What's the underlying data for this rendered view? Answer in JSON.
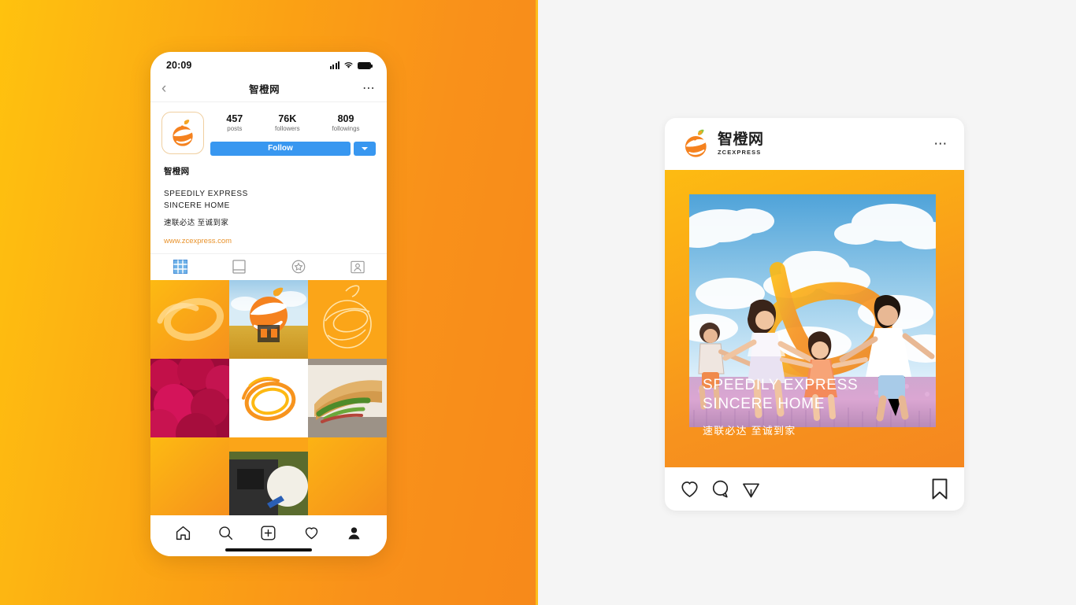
{
  "theme": {
    "brand_orange": "#F7931E",
    "brand_yellow": "#FFC20E",
    "link_orange": "#E8922B",
    "follow_blue": "#3897F0",
    "page_background": "#F5F5F5"
  },
  "phone": {
    "status_bar": {
      "time": "20:09",
      "icons": [
        "signal-icon",
        "wifi-icon",
        "battery-icon"
      ]
    },
    "nav": {
      "back_icon": "chevron-left-icon",
      "title": "智橙网",
      "more_icon": "more-horizontal-icon"
    },
    "profile": {
      "avatar_icon": "orange-logo-avatar",
      "stats": [
        {
          "value": "457",
          "label": "posts"
        },
        {
          "value": "76K",
          "label": "followers"
        },
        {
          "value": "809",
          "label": "followings"
        }
      ],
      "follow_label": "Follow",
      "follow_caret_icon": "chevron-down-icon",
      "bio_name": "智橙网",
      "bio_en_line1": "SPEEDILY EXPRESS",
      "bio_en_line2": "SINCERE HOME",
      "bio_cn": "速联必达 至诚到家",
      "bio_url": "www.zcexpress.com"
    },
    "tabs": [
      {
        "name": "tab-grid",
        "icon": "grid-icon",
        "active": true
      },
      {
        "name": "tab-feed",
        "icon": "list-card-icon",
        "active": false
      },
      {
        "name": "tab-saved",
        "icon": "star-circle-icon",
        "active": false
      },
      {
        "name": "tab-tagged",
        "icon": "person-card-icon",
        "active": false
      }
    ],
    "grid_posts": [
      {
        "name": "post-swirl-yellow",
        "kind": "orange-swirl-light"
      },
      {
        "name": "post-logo-field",
        "kind": "logo-over-field"
      },
      {
        "name": "post-outline-orange",
        "kind": "orange-outline"
      },
      {
        "name": "post-red-texture",
        "kind": "red-velvet-texture"
      },
      {
        "name": "post-swirl-white",
        "kind": "orange-swirl-white"
      },
      {
        "name": "post-sandwich",
        "kind": "baguette-sandwich"
      },
      {
        "name": "post-plain-orange-1",
        "kind": "flat-orange"
      },
      {
        "name": "post-worker",
        "kind": "worker-hat"
      },
      {
        "name": "post-plain-orange-2",
        "kind": "flat-orange"
      }
    ],
    "bottom_nav": [
      {
        "name": "nav-home",
        "icon": "home-icon"
      },
      {
        "name": "nav-search",
        "icon": "search-icon"
      },
      {
        "name": "nav-add",
        "icon": "plus-square-icon"
      },
      {
        "name": "nav-likes",
        "icon": "heart-icon"
      },
      {
        "name": "nav-profile",
        "icon": "person-icon"
      }
    ],
    "home_indicator": "home-indicator"
  },
  "post_card": {
    "brand_cn": "智橙网",
    "brand_en": "ZCEXPRESS",
    "brand_logo_icon": "orange-swoosh-logo",
    "more_icon": "more-horizontal-icon",
    "media": {
      "alt": "family-in-lavender-field",
      "overlay_line1": "SPEEDILY EXPRESS",
      "overlay_line2": "SINCERE HOME",
      "caption_cn": "速联必达 至诚到家"
    },
    "actions": [
      {
        "name": "like-button",
        "icon": "heart-icon"
      },
      {
        "name": "comment-button",
        "icon": "comment-icon"
      },
      {
        "name": "share-button",
        "icon": "share-paperplane-icon"
      },
      {
        "name": "save-button",
        "icon": "bookmark-icon"
      }
    ]
  }
}
